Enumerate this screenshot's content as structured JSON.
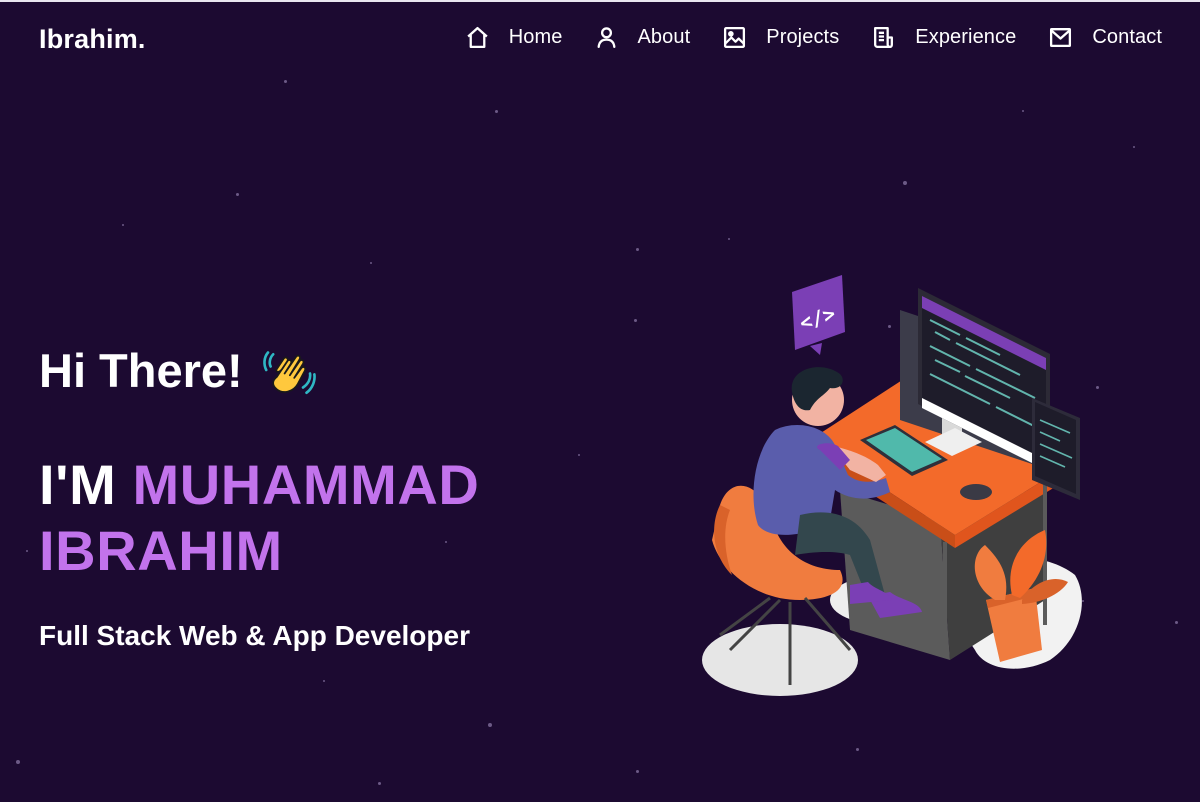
{
  "brand": {
    "name": "Ibrahim."
  },
  "nav": {
    "items": [
      {
        "label": "Home",
        "icon": "home-icon"
      },
      {
        "label": "About",
        "icon": "user-icon"
      },
      {
        "label": "Projects",
        "icon": "image-icon"
      },
      {
        "label": "Experience",
        "icon": "document-icon"
      },
      {
        "label": "Contact",
        "icon": "mail-icon"
      }
    ]
  },
  "hero": {
    "greeting": "Hi There!",
    "greeting_emoji": "waving-hand-icon",
    "name_prefix": "I'M",
    "name_first": "MUHAMMAD",
    "name_last": "IBRAHIM",
    "role": "Full Stack Web & App Developer"
  },
  "colors": {
    "background": "#1c0a31",
    "accent": "#c273ec",
    "text": "#ffffff"
  },
  "illustration": {
    "subject": "developer-at-desk-illustration",
    "code_badge_text": "</>"
  }
}
